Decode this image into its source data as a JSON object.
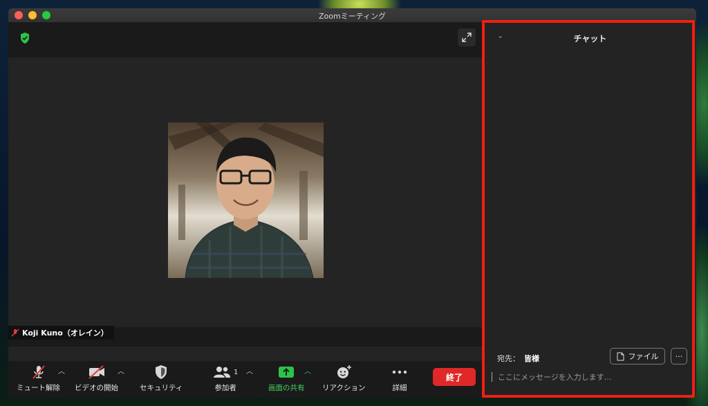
{
  "window": {
    "title": "Zoomミーティング"
  },
  "video": {
    "participant_name": "Koji Kuno（オレイン）"
  },
  "toolbar": {
    "mute_label": "ミュート解除",
    "video_label": "ビデオの開始",
    "security_label": "セキュリティ",
    "participants_label": "参加者",
    "participants_count": "1",
    "share_label": "画面の共有",
    "reaction_label": "リアクション",
    "more_label": "詳細",
    "end_label": "終了"
  },
  "chat": {
    "title": "チャット",
    "to_label": "宛先：",
    "to_value": "皆様",
    "file_label": "ファイル",
    "more_label": "···",
    "input_placeholder": "ここにメッセージを入力します..."
  },
  "colors": {
    "end_button": "#e02828",
    "share_green": "#42d15d",
    "highlight_border": "#f01f12"
  }
}
